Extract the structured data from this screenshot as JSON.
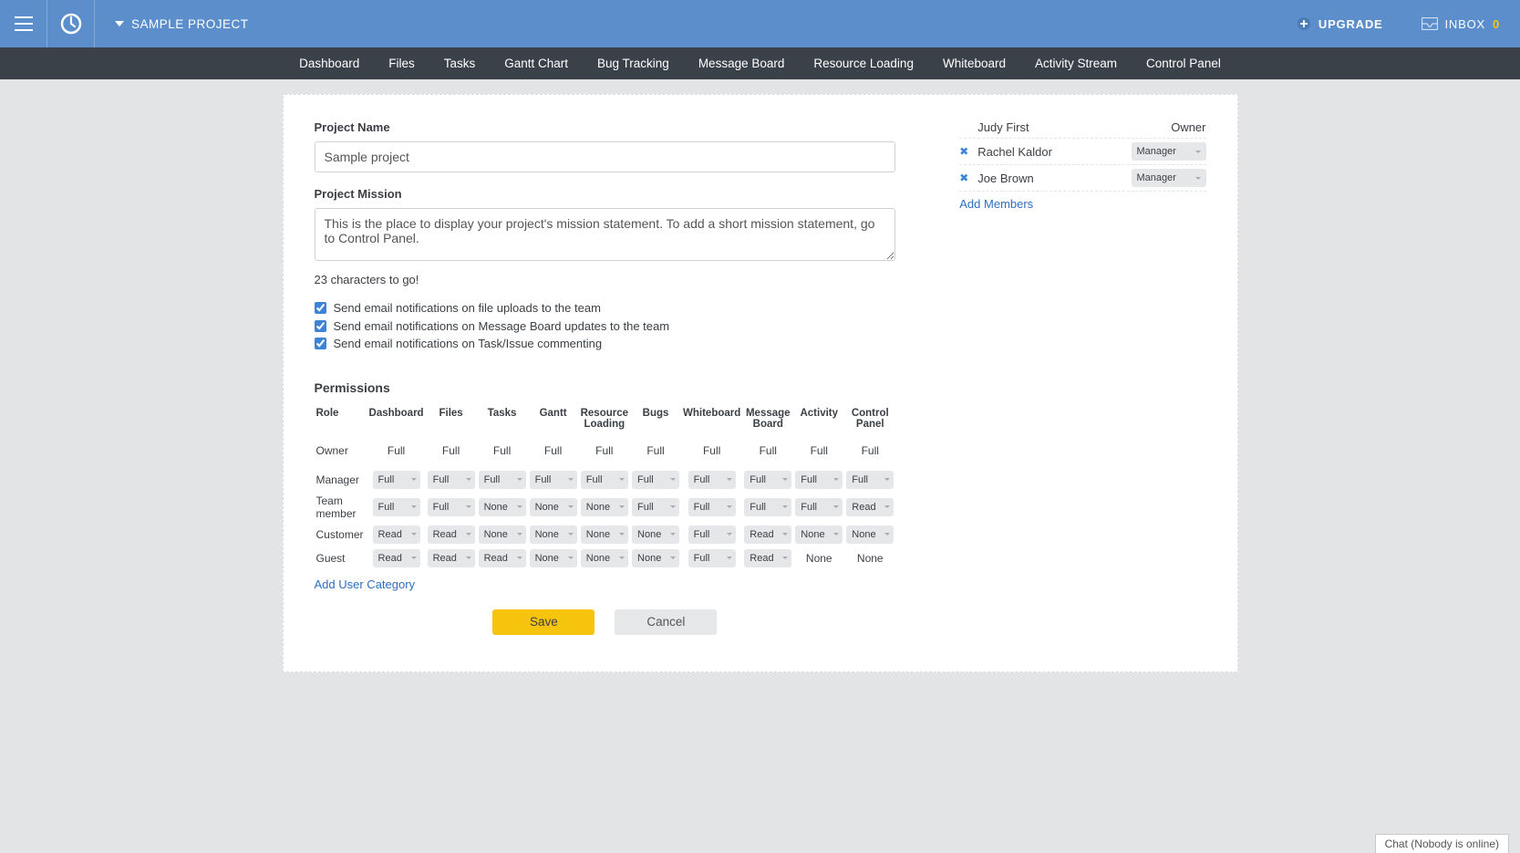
{
  "topbar": {
    "project_name": "SAMPLE PROJECT",
    "upgrade_label": "UPGRADE",
    "inbox_label": "INBOX",
    "inbox_count": "0"
  },
  "nav": {
    "items": [
      "Dashboard",
      "Files",
      "Tasks",
      "Gantt Chart",
      "Bug Tracking",
      "Message Board",
      "Resource Loading",
      "Whiteboard",
      "Activity Stream",
      "Control Panel"
    ]
  },
  "form": {
    "project_name_label": "Project Name",
    "project_name_value": "Sample project",
    "mission_label": "Project Mission",
    "mission_value": "This is the place to display your project's mission statement. To add a short mission statement, go to Control Panel.",
    "chars_helper": "23 characters to go!",
    "notify1": "Send email notifications on file uploads to the team",
    "notify2": "Send email notifications on Message Board updates to the team",
    "notify3": "Send email notifications on Task/Issue commenting",
    "permissions_h": "Permissions",
    "add_user_category": "Add User Category",
    "save_label": "Save",
    "cancel_label": "Cancel"
  },
  "permissions": {
    "headers": [
      "Role",
      "Dashboard",
      "Files",
      "Tasks",
      "Gantt",
      "Resource Loading",
      "Bugs",
      "Whiteboard",
      "Message Board",
      "Activity",
      "Control Panel"
    ],
    "rows": [
      {
        "role": "Owner",
        "type": "plain",
        "cells": [
          "Full",
          "Full",
          "Full",
          "Full",
          "Full",
          "Full",
          "Full",
          "Full",
          "Full",
          "Full"
        ]
      },
      {
        "role": "Manager",
        "type": "select",
        "cells": [
          "Full",
          "Full",
          "Full",
          "Full",
          "Full",
          "Full",
          "Full",
          "Full",
          "Full",
          "Full"
        ]
      },
      {
        "role": "Team member",
        "type": "select",
        "cells": [
          "Full",
          "Full",
          "None",
          "None",
          "None",
          "Full",
          "Full",
          "Full",
          "Full",
          "Read"
        ]
      },
      {
        "role": "Customer",
        "type": "select",
        "cells": [
          "Read",
          "Read",
          "None",
          "None",
          "None",
          "None",
          "Full",
          "Read",
          "None",
          "None"
        ]
      },
      {
        "role": "Guest",
        "type": "mixed",
        "cells": [
          {
            "v": "Read",
            "t": "select"
          },
          {
            "v": "Read",
            "t": "select"
          },
          {
            "v": "Read",
            "t": "select"
          },
          {
            "v": "None",
            "t": "select"
          },
          {
            "v": "None",
            "t": "select"
          },
          {
            "v": "None",
            "t": "select"
          },
          {
            "v": "Full",
            "t": "select"
          },
          {
            "v": "Read",
            "t": "select"
          },
          {
            "v": "None",
            "t": "plain"
          },
          {
            "v": "None",
            "t": "plain"
          }
        ]
      }
    ]
  },
  "members": {
    "list": [
      {
        "name": "Judy First",
        "role": "Owner",
        "type": "plain",
        "removable": false
      },
      {
        "name": "Rachel Kaldor",
        "role": "Manager",
        "type": "select",
        "removable": true
      },
      {
        "name": "Joe Brown",
        "role": "Manager",
        "type": "select",
        "removable": true
      }
    ],
    "add_label": "Add Members"
  },
  "chat": {
    "label": "Chat (Nobody is online)"
  }
}
